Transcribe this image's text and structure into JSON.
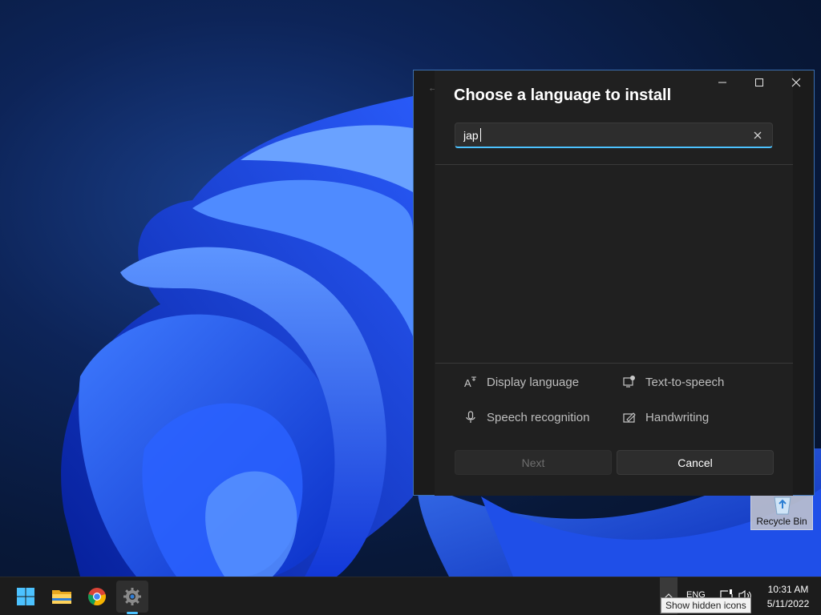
{
  "dialog": {
    "title": "Choose a language to install",
    "search": {
      "value": "jap",
      "placeholder": ""
    },
    "features": [
      {
        "label": "Display language",
        "icon": "display-language-icon"
      },
      {
        "label": "Text-to-speech",
        "icon": "text-to-speech-icon"
      },
      {
        "label": "Speech recognition",
        "icon": "microphone-icon"
      },
      {
        "label": "Handwriting",
        "icon": "handwriting-icon"
      }
    ],
    "buttons": {
      "next": "Next",
      "cancel": "Cancel"
    }
  },
  "desktop": {
    "recycle_bin_label": "Recycle Bin"
  },
  "taskbar": {
    "apps": [
      "start",
      "file-explorer",
      "chrome",
      "settings"
    ],
    "language": "ENG",
    "time": "10:31 AM",
    "date": "5/11/2022",
    "tooltip": "Show hidden icons"
  },
  "colors": {
    "accent": "#4cc2ff",
    "dialog_background": "#202020",
    "window_border": "#3b6fb0"
  }
}
